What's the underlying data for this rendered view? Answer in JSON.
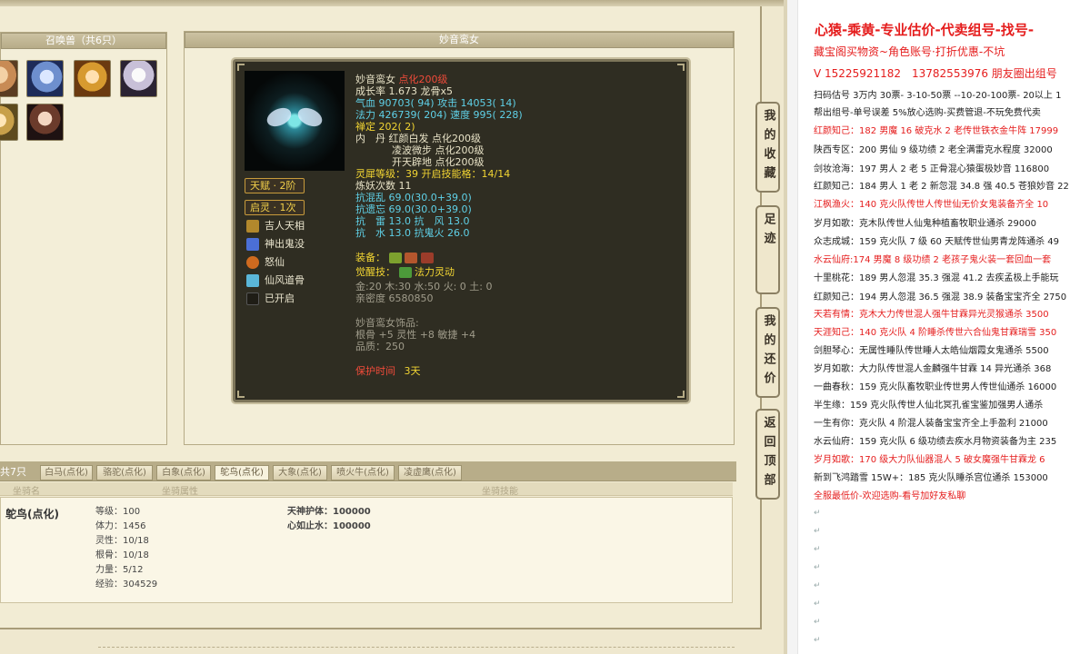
{
  "summon_panel": {
    "title": "召唤兽（共6只）"
  },
  "pet_panel": {
    "title": "妙音鸾女",
    "name": "妙音鸾女",
    "name_tag": "点化200级",
    "growth": "成长率 1.673 龙骨x5",
    "hp_label": "气血",
    "hp": "90703( 94) 攻击 14053( 14)",
    "mp_label": "法力",
    "mp": "426739( 204) 速度 995( 228)",
    "zen": "禅定 202( 2)",
    "dan1": "内　丹 红颜白发 点化200级",
    "dan2": "凌波微步 点化200级",
    "dan3": "开天辟地 点化200级",
    "spirit": "灵犀等级：39 开启技能格：14/14",
    "refine": "炼妖次数 11",
    "res1": "抗混乱 69.0(30.0+39.0)",
    "res2": "抗遗忘 69.0(30.0+39.0)",
    "res3": "抗　雷 13.0 抗　风 13.0",
    "res4": "抗　水 13.0 抗鬼火 26.0",
    "equip_label": "装备：",
    "awaken_label": "觉醒技：",
    "awaken_skill": "法力灵动",
    "elements": "金:20 木:30 水:50 火: 0 土: 0",
    "intimacy": "亲密度 6580850",
    "ornament_title": "妙音鸾女饰品:",
    "ornament_stats": "根骨 +5 灵性 +8 敏捷 +4",
    "ornament_quality": "品质：250",
    "protect_label": "保护时间",
    "protect_value": "3天",
    "tag_talent": "天赋 · 2阶",
    "tag_spirit": "启灵 · 1次",
    "skills": [
      "吉人天相",
      "神出鬼没",
      "怒仙",
      "仙风道骨",
      "已开启"
    ]
  },
  "mount_area": {
    "lead": "共7只",
    "tabs": [
      "白马(点化)",
      "骆驼(点化)",
      "白象(点化)",
      "鸵鸟(点化)",
      "大象(点化)",
      "喷火牛(点化)",
      "凌虚鹰(点化)"
    ],
    "col_name": "坐骑名",
    "col_attr": "坐骑属性",
    "col_skill": "坐骑技能",
    "mount_name": "鸵鸟(点化)",
    "attrs": [
      "等级：100",
      "体力：1456",
      "灵性：10/18",
      "根骨：10/18",
      "力量：5/12",
      "经验：304529"
    ],
    "skills": [
      "天神护体：100000",
      "心如止水：100000"
    ]
  },
  "side_tabs": [
    "我的收藏",
    "足迹",
    "我的还价",
    "返回顶部"
  ],
  "doc": {
    "lines": [
      {
        "t": "心猿-乘黄-专业估价-代卖组号-找号-",
        "c": "big"
      },
      {
        "t": "藏宝阁买物资~角色账号·打折优惠-不坑",
        "c": "mid"
      },
      {
        "t": "V 15225921182　13782553976 朋友圈出组号",
        "c": "mid"
      },
      {
        "t": "扫码估号 3万内 30票- 3-10-50票 --10-20-100票- 20以上 1",
        "c": ""
      },
      {
        "t": "帮出组号-单号误差 5%放心选购-买费管退-不玩免费代卖",
        "c": ""
      },
      {
        "t": "红颜知己：182 男魔 16 破克水 2 老传世铁衣金牛阵 17999",
        "c": "red"
      },
      {
        "t": "陕西专区：200 男仙 9 级功绩 2 老全满雷克水程度 32000",
        "c": ""
      },
      {
        "t": "剑妆沧海：197 男人 2 老 5 正骨混心猿蛋极妙音 116800",
        "c": ""
      },
      {
        "t": "红颜知己：184 男人 1 老 2 新忽混 34.8 强 40.5 苍狼妙音 22",
        "c": ""
      },
      {
        "t": "江枫渔火：140 克火队传世人传世仙无价女鬼装备齐全 10",
        "c": "red"
      },
      {
        "t": "岁月如歌：克木队传世人仙鬼种植畜牧职业通杀 29000",
        "c": ""
      },
      {
        "t": "众志成城：159 克火队 7 级 60 天赋传世仙男青龙阵通杀 49",
        "c": ""
      },
      {
        "t": "水云仙府:174 男魔 8 级功绩 2 老孩子鬼火装一套回血一套",
        "c": "red"
      },
      {
        "t": "十里桃花：189 男人忽混 35.3 强混 41.2 去疾孟极上手能玩",
        "c": ""
      },
      {
        "t": "红颜知己：194 男人忽混 36.5 强混 38.9 装备宝宝齐全 2750",
        "c": ""
      },
      {
        "t": "天若有情：克木大力传世混人强牛甘霖异光灵猴通杀 3500",
        "c": "red"
      },
      {
        "t": "天涯知己：140 克火队 4 阶睡杀传世六合仙鬼甘霖瑞雪 350",
        "c": "red"
      },
      {
        "t": "剑胆琴心：无属性睡队传世睡人太皓仙烟霞女鬼通杀 5500",
        "c": ""
      },
      {
        "t": "岁月如歌：大力队传世混人金麟强牛甘霖 14 异光通杀 368",
        "c": ""
      },
      {
        "t": "一曲春秋：159 克火队畜牧职业传世男人传世仙通杀 16000",
        "c": ""
      },
      {
        "t": "半生缘：159 克火队传世人仙北冥孔雀宝鉴加强男人通杀",
        "c": ""
      },
      {
        "t": "一生有你：克火队 4 阶混人装备宝宝齐全上手盈利 21000",
        "c": ""
      },
      {
        "t": "水云仙府：159 克火队 6 级功绩去疾水月物资装备为主 235",
        "c": ""
      },
      {
        "t": "岁月如歌：170 级大力队仙器混人 5 破女魔强牛甘霖龙 6",
        "c": "red"
      },
      {
        "t": "新到飞鸿踏雪 15W+：185 克火队睡杀宫位通杀 153000",
        "c": ""
      },
      {
        "t": "全服最低价-欢迎选购-看号加好友私聊",
        "c": "red"
      }
    ]
  }
}
